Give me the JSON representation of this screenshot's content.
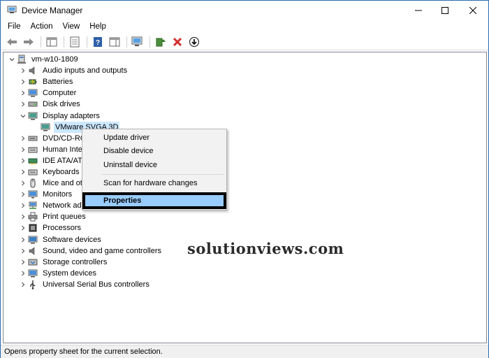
{
  "window": {
    "title": "Device Manager"
  },
  "menu": [
    "File",
    "Action",
    "View",
    "Help"
  ],
  "tree": {
    "root": "vm-w10-1809",
    "categories": [
      {
        "label": "Audio inputs and outputs",
        "icon": "speaker-icon",
        "expanded": false
      },
      {
        "label": "Batteries",
        "icon": "battery-icon",
        "expanded": false
      },
      {
        "label": "Computer",
        "icon": "computer-icon",
        "expanded": false
      },
      {
        "label": "Disk drives",
        "icon": "disk-drive-icon",
        "expanded": false
      },
      {
        "label": "Display adapters",
        "icon": "display-adapter-icon",
        "expanded": true
      },
      {
        "label": "VMware SVGA 3D",
        "icon": "display-adapter-icon",
        "child": true,
        "selected": true
      },
      {
        "label": "DVD/CD-RC",
        "icon": "dvd-icon",
        "expanded": false
      },
      {
        "label": "Human Inte",
        "icon": "keyboard-icon",
        "expanded": false
      },
      {
        "label": "IDE ATA/ATA",
        "icon": "ide-controller-icon",
        "expanded": false
      },
      {
        "label": "Keyboards",
        "icon": "keyboard-icon",
        "expanded": false
      },
      {
        "label": "Mice and ot",
        "icon": "mouse-icon",
        "expanded": false
      },
      {
        "label": "Monitors",
        "icon": "monitor-icon",
        "expanded": false
      },
      {
        "label": "Network ad",
        "icon": "network-icon",
        "expanded": false
      },
      {
        "label": "Print queues",
        "icon": "printer-icon",
        "expanded": false
      },
      {
        "label": "Processors",
        "icon": "processor-icon",
        "expanded": false
      },
      {
        "label": "Software devices",
        "icon": "software-device-icon",
        "expanded": false
      },
      {
        "label": "Sound, video and game controllers",
        "icon": "speaker-icon",
        "expanded": false
      },
      {
        "label": "Storage controllers",
        "icon": "storage-icon",
        "expanded": false
      },
      {
        "label": "System devices",
        "icon": "system-device-icon",
        "expanded": false
      },
      {
        "label": "Universal Serial Bus controllers",
        "icon": "usb-icon",
        "expanded": false
      }
    ]
  },
  "context_menu": {
    "items": [
      "Update driver",
      "Disable device",
      "Uninstall device"
    ],
    "scan": "Scan for hardware changes",
    "properties": "Properties"
  },
  "watermark": "solutionviews.com",
  "status": "Opens property sheet for the current selection.",
  "colors": {
    "selection": "#cce8ff",
    "highlight": "#99ccff",
    "remove_red": "#d32f2f",
    "titlebar_border": "#2b6cb0"
  }
}
